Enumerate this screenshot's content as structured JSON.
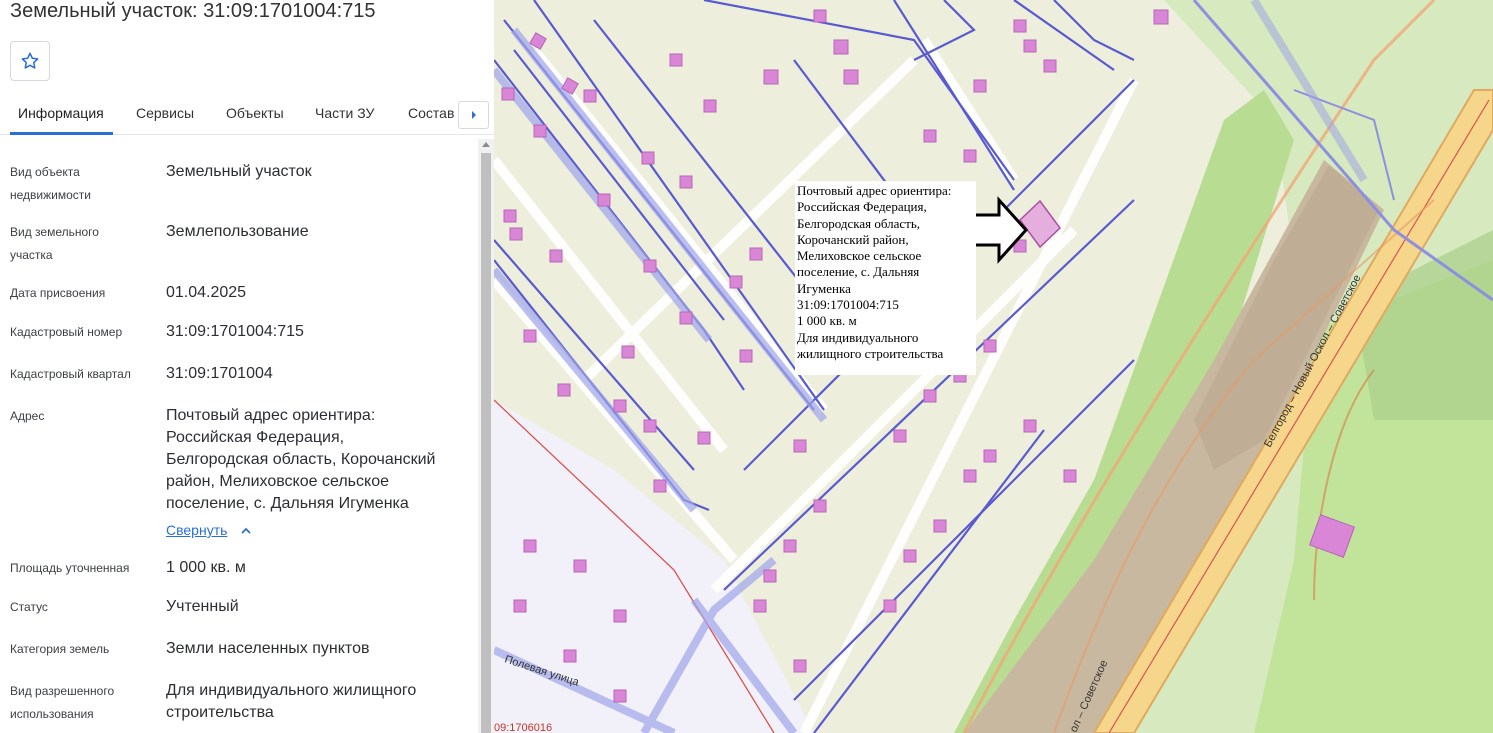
{
  "header": {
    "title": "Земельный участок: 31:09:1701004:715"
  },
  "tabs": [
    {
      "label": "Информация"
    },
    {
      "label": "Сервисы"
    },
    {
      "label": "Объекты"
    },
    {
      "label": "Части ЗУ"
    },
    {
      "label": "Состав"
    }
  ],
  "icons": {
    "favorite": "star-icon",
    "next": "caret-right-icon",
    "collapse": "chevron-up-icon"
  },
  "colors": {
    "accent": "#2a6fd6",
    "parcel": "#d886d0",
    "road": "#f6d58a",
    "forest": "#b6dc8f"
  },
  "info": {
    "object_type": {
      "label_line1": "Вид объекта",
      "label_line2": "недвижимости",
      "value": "Земельный участок"
    },
    "parcel_type": {
      "label_line1": "Вид земельного",
      "label_line2": "участка",
      "value": "Землепользование"
    },
    "date": {
      "label": "Дата присвоения",
      "value": "01.04.2025"
    },
    "cadastral_number": {
      "label": "Кадастровый номер",
      "value": "31:09:1701004:715"
    },
    "cadastral_block": {
      "label": "Кадастровый квартал",
      "value": "31:09:1701004"
    },
    "address": {
      "label": "Адрес",
      "lines": [
        "Почтовый адрес ориентира:",
        "Российская Федерация,",
        "Белгородская область, Корочанский",
        "район, Мелиховское сельское",
        "поселение, с. Дальняя Игуменка"
      ],
      "collapse_label": "Свернуть"
    },
    "area": {
      "label": "Площадь уточненная",
      "value": "1 000 кв. м"
    },
    "status": {
      "label": "Статус",
      "value": "Учтенный"
    },
    "category": {
      "label": "Категория земель",
      "value": "Земли населенных пунктов"
    },
    "permitted_use": {
      "label_line1": "Вид разрешенного",
      "label_line2": "использования",
      "value_line1": "Для индивидуального жилищного",
      "value_line2": "строительства"
    }
  },
  "map": {
    "popup_lines": [
      "Почтовый адрес ориентира:",
      "Российская Федерация,",
      "Белгородская область,",
      "Корочанский район,",
      "Мелиховское сельское",
      "поселение, с. Дальняя",
      "Игуменка",
      "31:09:1701004:715",
      "1 000 кв. м",
      "Для индивидуального",
      "жилищного строительства"
    ],
    "road_label": "Белгород – Новый Оскол – Советское",
    "road_label_bottom": "ол – Советское",
    "street_label": "Полевая улица",
    "block_label": "09:1706016"
  }
}
